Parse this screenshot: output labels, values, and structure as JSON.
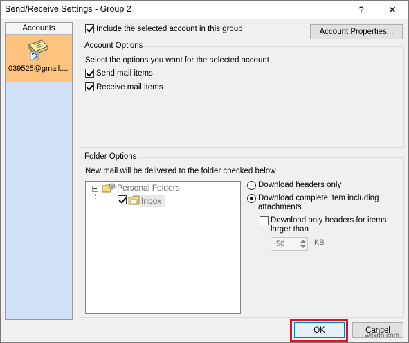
{
  "window": {
    "title": "Send/Receive Settings - Group 2",
    "help_glyph": "?",
    "close_glyph": "✕"
  },
  "accounts": {
    "header": "Accounts",
    "items": [
      {
        "label": "039525@gmail...."
      }
    ]
  },
  "include": {
    "label": "Include the selected account in this group",
    "checked": true
  },
  "account_properties_label": "Account Properties...",
  "account_options": {
    "legend": "Account Options",
    "description": "Select the options you want for the selected account",
    "send": {
      "label": "Send mail items",
      "checked": true
    },
    "receive": {
      "label": "Receive mail items",
      "checked": true
    }
  },
  "folder_options": {
    "legend": "Folder Options",
    "description": "New mail will be delivered to the folder checked below",
    "tree": {
      "root": "Personal Folders",
      "child": "Inbox",
      "child_checked": true
    },
    "download_headers": "Download headers only",
    "download_complete_line1": "Download complete item including",
    "download_complete_line2": "attachments",
    "headers_large_line1": "Download only headers for items",
    "headers_large_line2": "larger than",
    "size_value": "50",
    "size_unit": "KB"
  },
  "footer": {
    "ok_label": "OK",
    "cancel_label": "Cancel"
  },
  "watermark": "wsxdn.com",
  "colors": {
    "accent": "#0078d7",
    "selected_account": "#fdc27d",
    "accounts_panel": "#cfe0f8",
    "highlight": "#e0141e"
  }
}
